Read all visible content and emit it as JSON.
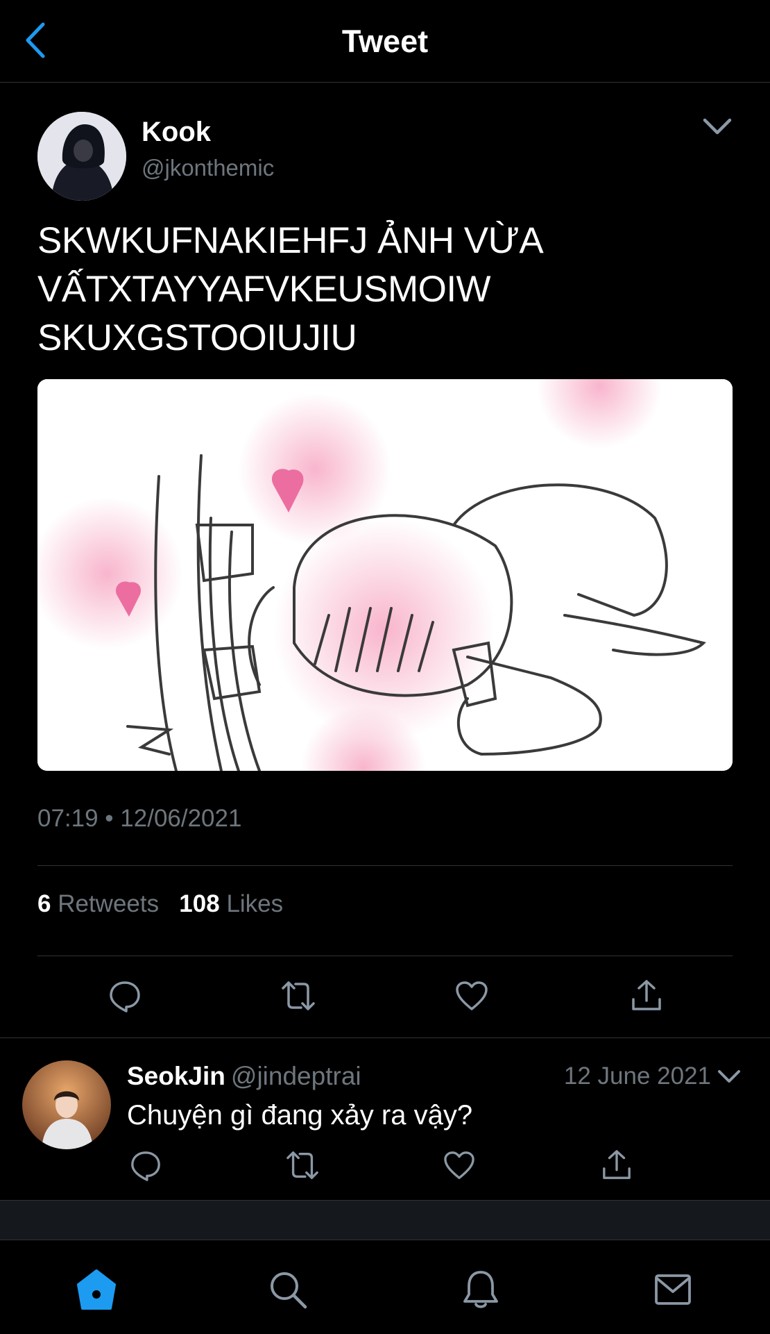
{
  "header": {
    "title": "Tweet",
    "back_icon": "chevron-left-icon"
  },
  "tweet": {
    "author_name": "Kook",
    "author_handle": "@jkonthemic",
    "text": "SKWKUFNAKIEHFJ ẢNH VỪA VẤTXTAYYAFVKEUSMOIW SKUXGSTOOIUJIU",
    "timestamp": "07:19 • 12/06/2021",
    "retweets_count": "6",
    "retweets_label": "Retweets",
    "likes_count": "108",
    "likes_label": "Likes",
    "actions": [
      "reply-icon",
      "retweet-icon",
      "like-icon",
      "share-icon"
    ]
  },
  "reply": {
    "author_name": "SeokJin",
    "author_handle": "@jindeptrai",
    "date": "12 June 2021",
    "text": "Chuyện gì đang xảy ra vậy?"
  },
  "tabbar": {
    "items": [
      "home-icon",
      "search-icon",
      "notifications-icon",
      "messages-icon"
    ],
    "active": "home-icon"
  },
  "colors": {
    "accent": "#1d9bf0",
    "background": "#000000",
    "secondary_text": "#6e767d",
    "divider": "#2f3336"
  }
}
